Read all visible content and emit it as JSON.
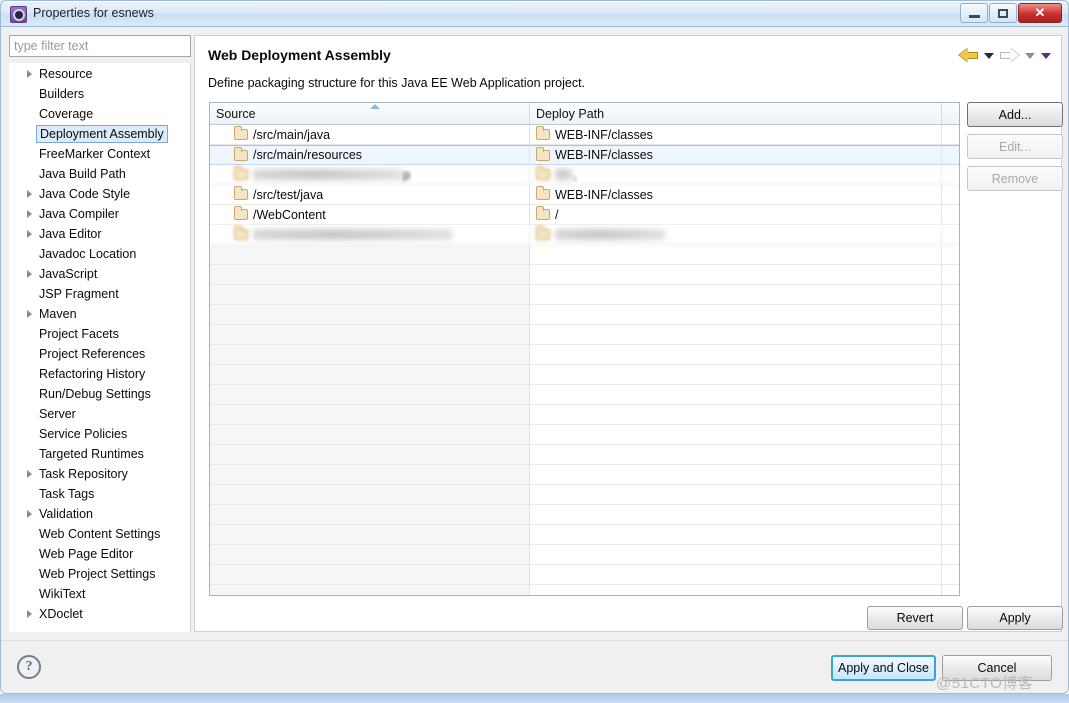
{
  "window": {
    "title": "Properties for esnews",
    "icon": "gear-icon",
    "minimize_label": "",
    "maximize_label": "",
    "close_label": "✕"
  },
  "filter": {
    "placeholder": "type filter text",
    "value": ""
  },
  "sidebar": {
    "items": [
      {
        "label": "Resource",
        "expandable": true,
        "selected": false
      },
      {
        "label": "Builders",
        "expandable": false,
        "selected": false
      },
      {
        "label": "Coverage",
        "expandable": false,
        "selected": false
      },
      {
        "label": "Deployment Assembly",
        "expandable": false,
        "selected": true
      },
      {
        "label": "FreeMarker Context",
        "expandable": false,
        "selected": false
      },
      {
        "label": "Java Build Path",
        "expandable": false,
        "selected": false
      },
      {
        "label": "Java Code Style",
        "expandable": true,
        "selected": false
      },
      {
        "label": "Java Compiler",
        "expandable": true,
        "selected": false
      },
      {
        "label": "Java Editor",
        "expandable": true,
        "selected": false
      },
      {
        "label": "Javadoc Location",
        "expandable": false,
        "selected": false
      },
      {
        "label": "JavaScript",
        "expandable": true,
        "selected": false
      },
      {
        "label": "JSP Fragment",
        "expandable": false,
        "selected": false
      },
      {
        "label": "Maven",
        "expandable": true,
        "selected": false
      },
      {
        "label": "Project Facets",
        "expandable": false,
        "selected": false
      },
      {
        "label": "Project References",
        "expandable": false,
        "selected": false
      },
      {
        "label": "Refactoring History",
        "expandable": false,
        "selected": false
      },
      {
        "label": "Run/Debug Settings",
        "expandable": false,
        "selected": false
      },
      {
        "label": "Server",
        "expandable": false,
        "selected": false
      },
      {
        "label": "Service Policies",
        "expandable": false,
        "selected": false
      },
      {
        "label": "Targeted Runtimes",
        "expandable": false,
        "selected": false
      },
      {
        "label": "Task Repository",
        "expandable": true,
        "selected": false
      },
      {
        "label": "Task Tags",
        "expandable": false,
        "selected": false
      },
      {
        "label": "Validation",
        "expandable": true,
        "selected": false
      },
      {
        "label": "Web Content Settings",
        "expandable": false,
        "selected": false
      },
      {
        "label": "Web Page Editor",
        "expandable": false,
        "selected": false
      },
      {
        "label": "Web Project Settings",
        "expandable": false,
        "selected": false
      },
      {
        "label": "WikiText",
        "expandable": false,
        "selected": false
      },
      {
        "label": "XDoclet",
        "expandable": true,
        "selected": false
      }
    ]
  },
  "content": {
    "title": "Web Deployment Assembly",
    "description": "Define packaging structure for this Java EE Web Application project.",
    "nav": {
      "back_icon": "back-arrow-icon",
      "back_caret_icon": "chevron-down-icon",
      "forward_icon": "forward-arrow-icon",
      "forward_caret_icon": "chevron-down-icon",
      "menu_caret_icon": "chevron-down-icon"
    }
  },
  "table": {
    "columns": [
      "Source",
      "Deploy Path",
      ""
    ],
    "sort_column": "Source",
    "sort_direction": "ascending",
    "rows": [
      {
        "source": "/src/main/java",
        "deploy": "WEB-INF/classes",
        "selected": false,
        "redacted": false
      },
      {
        "source": "/src/main/resources",
        "deploy": "WEB-INF/classes",
        "selected": true,
        "redacted": false
      },
      {
        "source": "p",
        "deploy": ",",
        "selected": false,
        "redacted": true
      },
      {
        "source": "/src/test/java",
        "deploy": "WEB-INF/classes",
        "selected": false,
        "redacted": false
      },
      {
        "source": "/WebContent",
        "deploy": "/",
        "selected": false,
        "redacted": false
      },
      {
        "source": "",
        "deploy": "",
        "selected": false,
        "redacted": true
      }
    ],
    "empty_row_count": 22
  },
  "buttons": {
    "add": "Add...",
    "edit": "Edit...",
    "remove": "Remove",
    "revert": "Revert",
    "apply": "Apply",
    "apply_and_close": "Apply and Close",
    "cancel": "Cancel"
  },
  "footer": {
    "help_icon": "question-mark-icon",
    "help_glyph": "?"
  },
  "watermark": "@51CTO博客"
}
